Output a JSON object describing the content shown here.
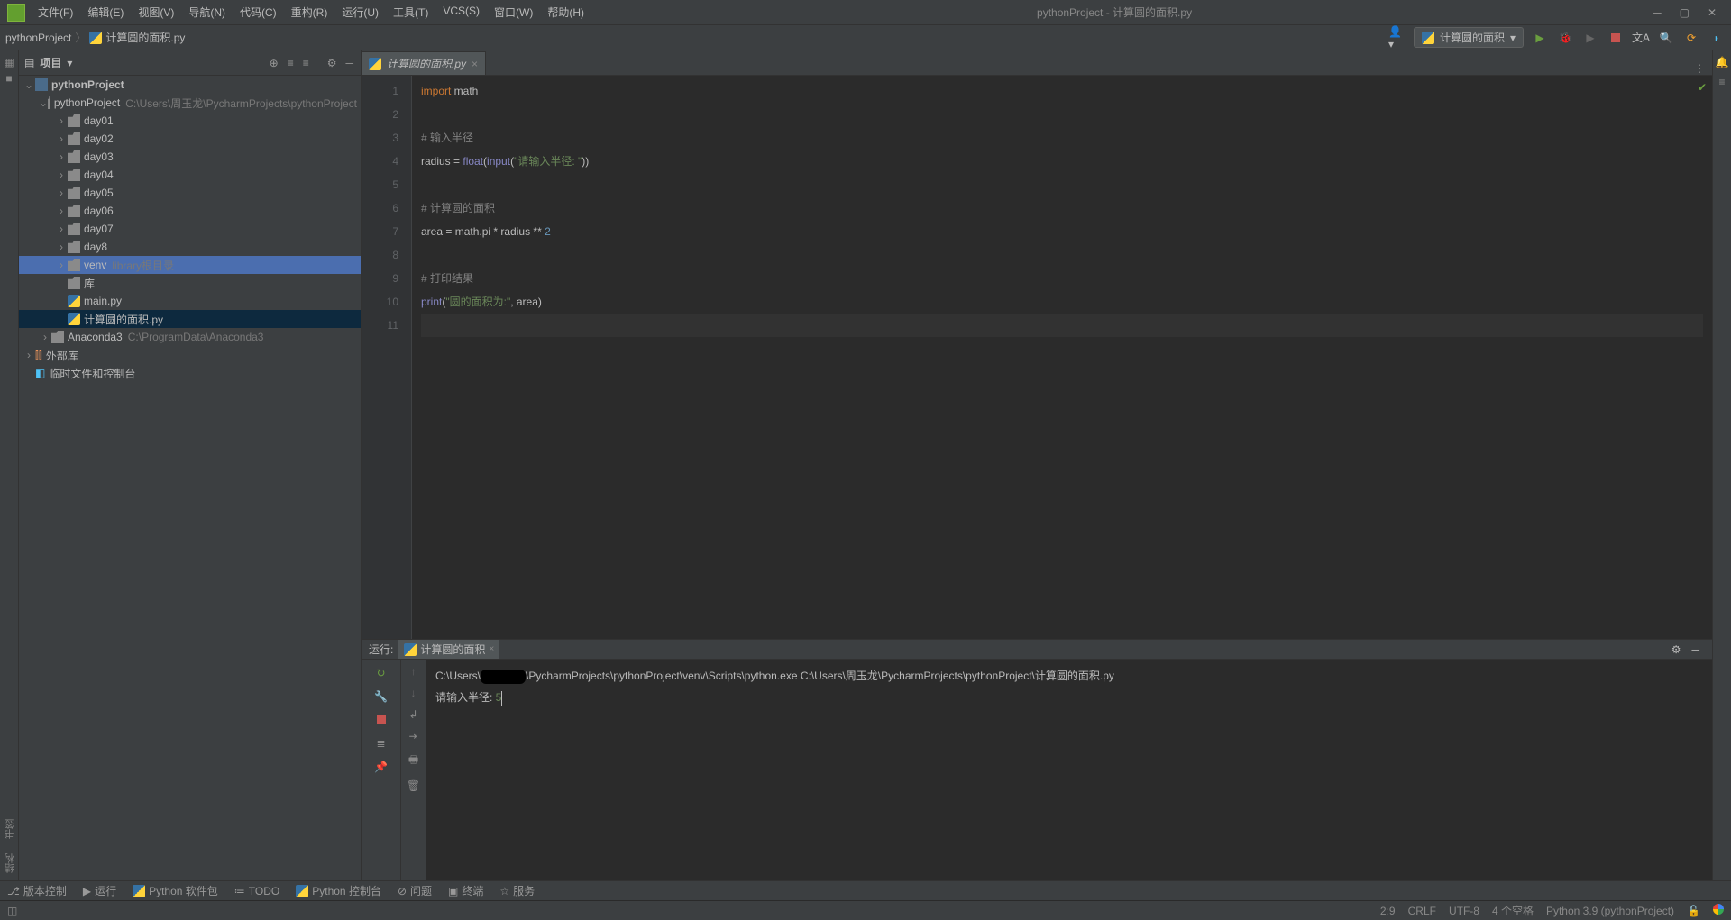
{
  "window": {
    "title": "pythonProject - 计算圆的面积.py",
    "menus": [
      "文件(F)",
      "编辑(E)",
      "视图(V)",
      "导航(N)",
      "代码(C)",
      "重构(R)",
      "运行(U)",
      "工具(T)",
      "VCS(S)",
      "窗口(W)",
      "帮助(H)"
    ]
  },
  "breadcrumb": {
    "root": "pythonProject",
    "file": "计算圆的面积.py"
  },
  "runConfig": "计算圆的面积",
  "projectPanel": {
    "title": "项目"
  },
  "tree": {
    "root": "pythonProject",
    "inner": "pythonProject",
    "innerPath": "C:\\Users\\周玉龙\\PycharmProjects\\pythonProject",
    "days": [
      "day01",
      "day02",
      "day03",
      "day04",
      "day05",
      "day06",
      "day07",
      "day8"
    ],
    "venv": "venv",
    "venvHint": "library根目录",
    "lib": "库",
    "main": "main.py",
    "curFile": "计算圆的面积.py",
    "anaconda": "Anaconda3",
    "anacondaPath": "C:\\ProgramData\\Anaconda3",
    "ext": "外部库",
    "scratch": "临时文件和控制台"
  },
  "editorTab": "计算圆的面积.py",
  "code": {
    "l1": {
      "k": "import",
      "r": " math"
    },
    "l3": "# 输入半径",
    "l4": {
      "a": "radius = ",
      "f1": "float",
      "b": "(",
      "f2": "input",
      "c": "(",
      "s": "\"请输入半径: \"",
      "d": "))"
    },
    "l6": "# 计算圆的面积",
    "l7": {
      "a": "area = math.pi * radius ** ",
      "n": "2"
    },
    "l9": "# 打印结果",
    "l10": {
      "f": "print",
      "a": "(",
      "s": "\"圆的面积为:\"",
      "b": ", area)"
    }
  },
  "runPanel": {
    "label": "运行:",
    "tab": "计算圆的面积",
    "line1a": "C:\\Users\\",
    "line1b": "\\PycharmProjects\\pythonProject\\venv\\Scripts\\python.exe C:\\Users\\周玉龙\\PycharmProjects\\pythonProject\\计算圆的面积.py",
    "line2a": "请输入半径: ",
    "line2b": "5"
  },
  "bottomTabs": {
    "vc": "版本控制",
    "run": "运行",
    "pkg": "Python 软件包",
    "todo": "TODO",
    "pycon": "Python 控制台",
    "prob": "问题",
    "term": "终端",
    "svc": "服务"
  },
  "status": {
    "pos": "2:9",
    "eol": "CRLF",
    "enc": "UTF-8",
    "indent": "4 个空格",
    "interp": "Python 3.9 (pythonProject)"
  },
  "leftRail": {
    "structure": "结构",
    "bookmarks": "书签"
  }
}
